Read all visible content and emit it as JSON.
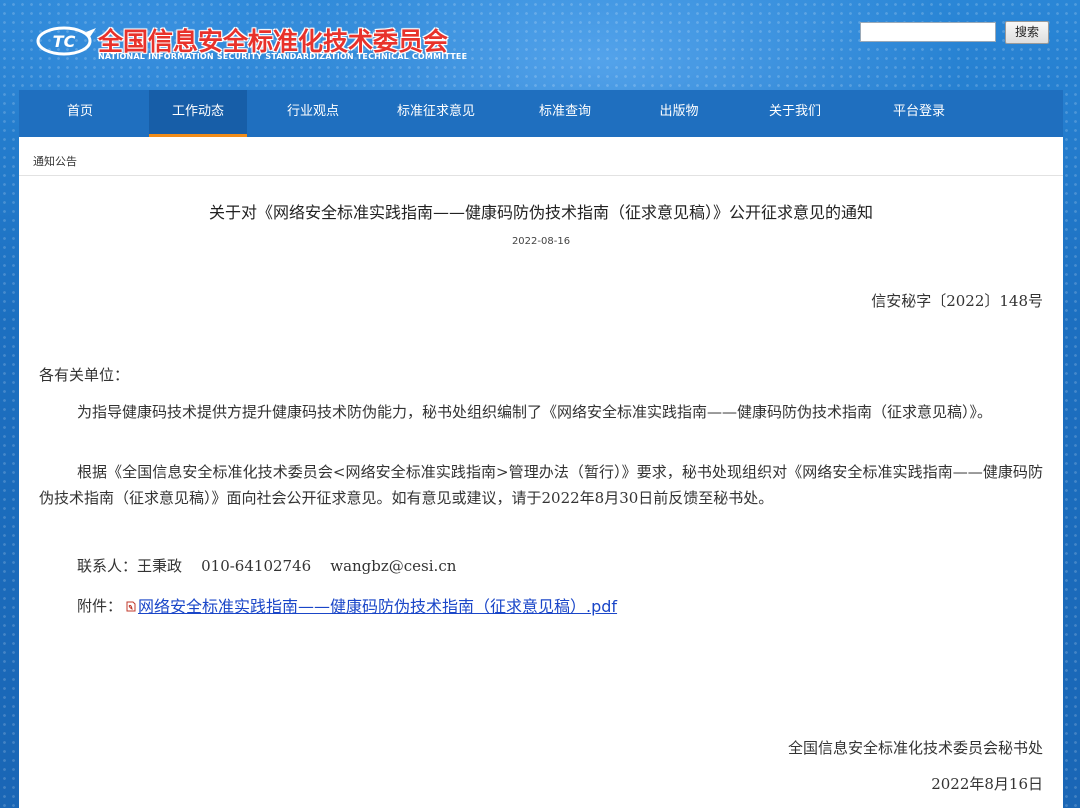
{
  "header": {
    "logo_title": "全国信息安全标准化技术委员会",
    "logo_subtitle": "NATIONAL INFORMATION SECURITY STANDARDIZATION TECHNICAL COMMITTEE",
    "search_placeholder": "",
    "search_button": "搜索"
  },
  "nav": {
    "active_index": 1,
    "items": [
      "首页",
      "工作动态",
      "行业观点",
      "标准征求意见",
      "标准查询",
      "出版物",
      "关于我们",
      "平台登录"
    ]
  },
  "breadcrumb": "通知公告",
  "article": {
    "title": "关于对《网络安全标准实践指南——健康码防伪技术指南（征求意见稿）》公开征求意见的通知",
    "date": "2022-08-16",
    "doc_number": "信安秘字〔2022〕148号",
    "salutation": "各有关单位：",
    "paragraphs": [
      "为指导健康码技术提供方提升健康码技术防伪能力，秘书处组织编制了《网络安全标准实践指南——健康码防伪技术指南（征求意见稿）》。",
      "根据《全国信息安全标准化技术委员会<网络安全标准实践指南>管理办法（暂行）》要求，秘书处现组织对《网络安全标准实践指南——健康码防伪技术指南（征求意见稿）》面向社会公开征求意见。如有意见或建议，请于2022年8月30日前反馈至秘书处。"
    ],
    "contact_label": "联系人：",
    "contact_name": "王秉政",
    "contact_phone": "010-64102746",
    "contact_email": "wangbz@cesi.cn",
    "attachment_label": "附件：",
    "attachment_link": "网络安全标准实践指南——健康码防伪技术指南（征求意见稿）.pdf",
    "signature_org": "全国信息安全标准化技术委员会秘书处",
    "signature_date": "2022年8月16日"
  },
  "colors": {
    "brand_blue": "#1f74c4",
    "nav_blue": "#1f6fbf",
    "active_underline": "#f08c1a",
    "logo_red": "#e8322b",
    "link_blue": "#1a46c8"
  }
}
